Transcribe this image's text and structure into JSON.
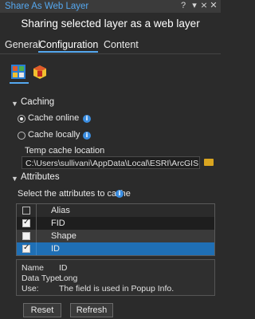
{
  "window": {
    "title": "Share As Web Layer",
    "help_glyph": "?",
    "minimize_glyph": "▾",
    "pin_glyph": "⨯",
    "close_glyph": "✕"
  },
  "subtitle": "Sharing selected layer as a web layer",
  "tabs": [
    {
      "label": "General"
    },
    {
      "label": "Configuration"
    },
    {
      "label": "Content"
    }
  ],
  "subtabs": [
    {
      "icon": "feature-layer-icon"
    },
    {
      "icon": "tile-layer-icon"
    }
  ],
  "caching": {
    "header": "Caching",
    "option_online": "Cache online",
    "option_locally": "Cache locally",
    "temp_label": "Temp cache location",
    "temp_path": "C:\\Users\\sullivani\\AppData\\Local\\ESRI\\ArcGISPro\\Sta"
  },
  "attributes": {
    "header": "Attributes",
    "instruction": "Select the attributes to cache",
    "column_header": "Alias",
    "rows": [
      {
        "alias": "FID",
        "checked": true
      },
      {
        "alias": "Shape",
        "checked": false
      },
      {
        "alias": "ID",
        "checked": true
      }
    ]
  },
  "details": {
    "name_label": "Name",
    "name_value": "ID",
    "type_label": "Data Type:",
    "type_value": "Long",
    "use_label": "Use:",
    "use_value": "The field is used in Popup Info."
  },
  "buttons": {
    "reset": "Reset",
    "refresh": "Refresh"
  },
  "colors": {
    "accent": "#55a8f0",
    "selected_row": "#1f6fb5",
    "background": "#2b2b2b"
  }
}
